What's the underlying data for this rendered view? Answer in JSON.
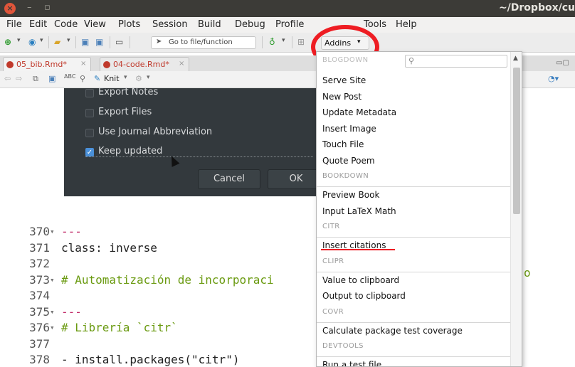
{
  "window": {
    "title": "~/Dropbox/cu",
    "close_glyph": "×",
    "minimize_glyph": "–",
    "maximize_glyph": "▫"
  },
  "menubar": {
    "items": [
      "File",
      "Edit",
      "Code",
      "View",
      "Plots",
      "Session",
      "Build",
      "Debug",
      "Profile",
      "Tools",
      "Help"
    ]
  },
  "toolbar": {
    "goto_placeholder": "Go to file/function",
    "addins_label": "Addins",
    "addins_caret": "▾"
  },
  "editor_tabs": [
    {
      "label": "05_bib.Rmd*",
      "close": "×"
    },
    {
      "label": "04-code.Rmd*",
      "close": "×"
    }
  ],
  "editor_toolbar": {
    "knit_label": "Knit",
    "knit_caret": "▾",
    "spell_label": "ABC"
  },
  "dialog": {
    "options": [
      {
        "label": "Export Notes",
        "checked": false
      },
      {
        "label": "Export Files",
        "checked": false
      },
      {
        "label": "Use Journal Abbreviation",
        "checked": false
      },
      {
        "label": "Keep updated",
        "checked": true
      }
    ],
    "cancel_label": "Cancel",
    "ok_label": "OK"
  },
  "code_lines": [
    {
      "num": "370",
      "fold": "▾",
      "text": "---",
      "kind": "dash"
    },
    {
      "num": "371",
      "fold": "",
      "text": "class: inverse",
      "kind": "plain"
    },
    {
      "num": "372",
      "fold": "",
      "text": "",
      "kind": "plain"
    },
    {
      "num": "373",
      "fold": "▾",
      "text": "# Automatización de incorporaci",
      "kind": "head"
    },
    {
      "num": "374",
      "fold": "",
      "text": "",
      "kind": "plain"
    },
    {
      "num": "375",
      "fold": "▾",
      "text": "---",
      "kind": "dash"
    },
    {
      "num": "376",
      "fold": "▾",
      "text": "# Librería `citr`",
      "kind": "head"
    },
    {
      "num": "377",
      "fold": "",
      "text": "",
      "kind": "plain"
    },
    {
      "num": "378",
      "fold": "",
      "text": "- install.packages(\"citr\")",
      "kind": "plain"
    }
  ],
  "code_overflow_tail": "o",
  "addins_menu": {
    "search_icon": "search-icon",
    "hidden_group": "BLOGDOWN",
    "entries": [
      {
        "type": "item",
        "label": "Serve Site"
      },
      {
        "type": "item",
        "label": "New Post"
      },
      {
        "type": "item",
        "label": "Update Metadata"
      },
      {
        "type": "item",
        "label": "Insert Image"
      },
      {
        "type": "item",
        "label": "Touch File"
      },
      {
        "type": "item",
        "label": "Quote Poem"
      },
      {
        "type": "group",
        "label": "BOOKDOWN"
      },
      {
        "type": "item",
        "label": "Preview Book"
      },
      {
        "type": "item",
        "label": "Input LaTeX Math"
      },
      {
        "type": "group",
        "label": "CITR"
      },
      {
        "type": "item",
        "label": "Insert citations",
        "highlighted": true
      },
      {
        "type": "group",
        "label": "CLIPR"
      },
      {
        "type": "item",
        "label": "Value to clipboard"
      },
      {
        "type": "item",
        "label": "Output to clipboard"
      },
      {
        "type": "group",
        "label": "COVR"
      },
      {
        "type": "item",
        "label": "Calculate package test coverage"
      },
      {
        "type": "group",
        "label": "DEVTOOLS"
      },
      {
        "type": "item",
        "label": "Run a test file"
      }
    ]
  },
  "colors": {
    "highlight_ring": "#ee1d23",
    "dialog_bg": "#33393d",
    "title_bar": "#3c3b37",
    "rmd_tab_red": "#c0392b",
    "code_heading": "#6a9a10",
    "code_dash": "#c22d6a"
  }
}
